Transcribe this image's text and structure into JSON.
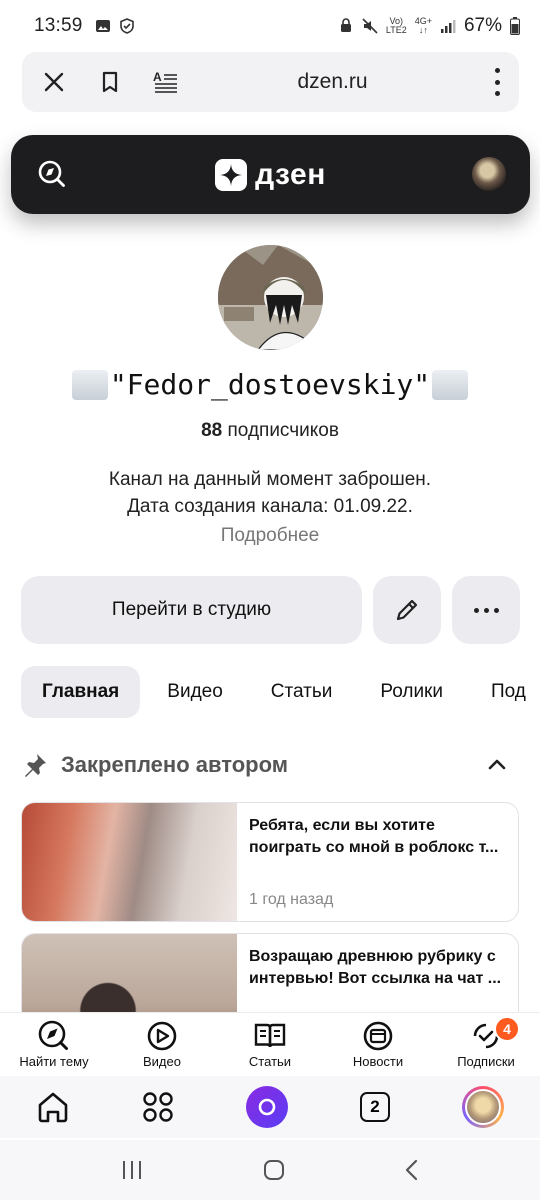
{
  "status_bar": {
    "time": "13:59",
    "network_top": "Vo)",
    "network_bottom": "LTE2",
    "signal_label_top": "4G+",
    "battery": "67%"
  },
  "browser": {
    "url": "dzen.ru"
  },
  "header": {
    "logo_text": "дзен"
  },
  "channel": {
    "name": "\"Fedor_dostoevskiy\"",
    "subscribers_count": "88",
    "subscribers_label": "подписчиков",
    "description_line1": "Канал на данный момент заброшен.",
    "description_line2": "Дата создания канала: 01.09.22.",
    "more_link": "Подробнее"
  },
  "actions": {
    "studio_label": "Перейти в студию"
  },
  "tabs": [
    {
      "label": "Главная",
      "active": true
    },
    {
      "label": "Видео",
      "active": false
    },
    {
      "label": "Статьи",
      "active": false
    },
    {
      "label": "Ролики",
      "active": false
    },
    {
      "label": "Под",
      "active": false
    }
  ],
  "pinned": {
    "title": "Закреплено автором",
    "cards": [
      {
        "title": "Ребята, если вы хотите поиграть со мной в роблокс т...",
        "meta": "1 год назад"
      },
      {
        "title": "Возращаю древнюю рубрику с интервью! Вот ссылка на чат ...",
        "meta": ""
      }
    ]
  },
  "bottom_nav": {
    "items": [
      {
        "label": "Найти тему",
        "icon": "compass-icon"
      },
      {
        "label": "Видео",
        "icon": "play-icon"
      },
      {
        "label": "Статьи",
        "icon": "book-icon"
      },
      {
        "label": "Новости",
        "icon": "news-icon"
      },
      {
        "label": "Подписки",
        "icon": "subscriptions-icon"
      }
    ],
    "subscriptions_badge": "4"
  },
  "browser_toolbar": {
    "tabs_count": "2"
  },
  "colors": {
    "header_bg": "#1d1d1f",
    "button_bg": "#ececf0",
    "badge": "#ff5a1f",
    "alice": "#7a35f0"
  }
}
